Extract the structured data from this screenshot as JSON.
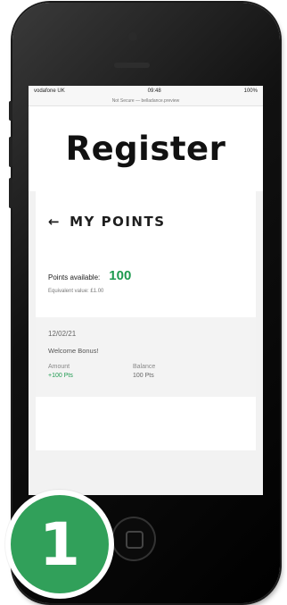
{
  "status_bar": {
    "carrier": "vodafone UK",
    "time": "09:48",
    "battery": "100%"
  },
  "url_bar": {
    "text": "Not Secure — belladance.preview"
  },
  "header": {
    "title": "Register"
  },
  "points": {
    "heading": "MY POINTS",
    "back_icon": "arrow-left-icon",
    "available_label": "Points available:",
    "available_value": "100",
    "equivalent": "Equivalent value: £1.00"
  },
  "transaction": {
    "date": "12/02/21",
    "description": "Welcome Bonus!",
    "amount_label": "Amount",
    "amount_value": "+100 Pts",
    "balance_label": "Balance",
    "balance_value": "100 Pts"
  },
  "badge": {
    "number": "1"
  },
  "colors": {
    "accent_green": "#1e9a50",
    "badge_green": "#31a05a"
  }
}
